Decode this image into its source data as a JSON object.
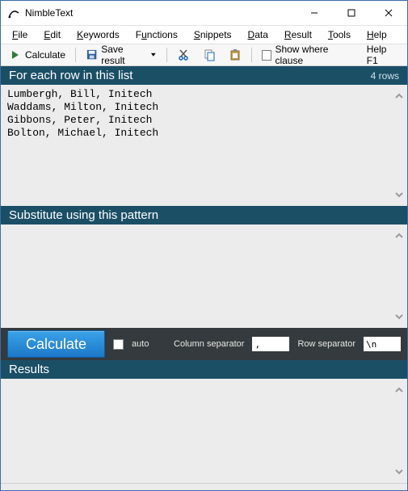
{
  "window": {
    "title": "NimbleText"
  },
  "menu": {
    "file": "File",
    "edit": "Edit",
    "keywords": "Keywords",
    "functions": "Functions",
    "snippets": "Snippets",
    "data": "Data",
    "result": "Result",
    "tools": "Tools",
    "help": "Help"
  },
  "toolbar": {
    "calculate": "Calculate",
    "save_result": "Save result",
    "show_where_clause": "Show where clause",
    "help_hint": "Help F1",
    "icons": {
      "play": "play-icon",
      "save": "save-icon",
      "cut": "cut-icon",
      "copy": "copy-icon",
      "paste": "paste-icon"
    }
  },
  "sections": {
    "input": {
      "title": "For each row in this list",
      "rowcount": "4 rows"
    },
    "pattern": {
      "title": "Substitute using this pattern"
    },
    "results": {
      "title": "Results"
    }
  },
  "input_text": "Lumbergh, Bill, Initech\nWaddams, Milton, Initech\nGibbons, Peter, Initech\nBolton, Michael, Initech",
  "pattern_text": "",
  "results_text": "",
  "calcbar": {
    "button": "Calculate",
    "auto_label": "auto",
    "colsep_label": "Column separator",
    "colsep_value": ",",
    "rowsep_label": "Row separator",
    "rowsep_value": "\\n"
  }
}
